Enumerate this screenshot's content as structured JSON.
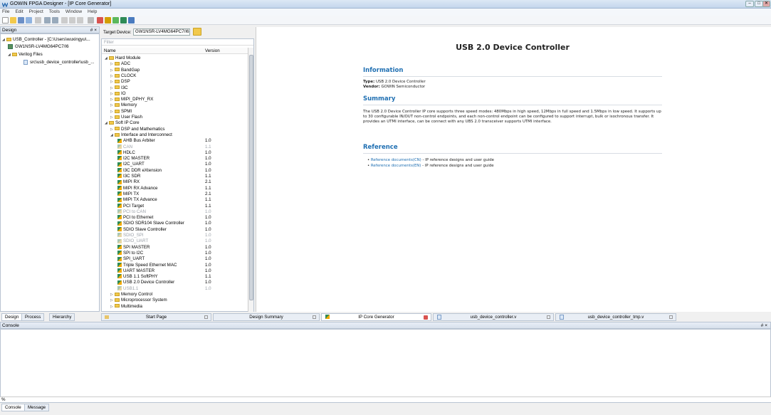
{
  "window": {
    "title": "GOWIN FPGA Designer - [IP Core Generator]",
    "min": "–",
    "max": "□",
    "close": "✕"
  },
  "menu": [
    "File",
    "Edit",
    "Project",
    "Tools",
    "Window",
    "Help"
  ],
  "design": {
    "header": "Design",
    "header_btns": "# ×",
    "project": "USB_Controller - [C:\\Users\\wuxingyu\\...",
    "device": "GW1NSR-LV4MG64PC7/I6",
    "verilog": "Verilog Files",
    "file": "src\\usb_device_controller\\usb_..."
  },
  "target": {
    "label": "Target Device:",
    "value": "GW1NSR-LV4MG64PC7/I6"
  },
  "filter": {
    "label": "Filter"
  },
  "tree": {
    "col_name": "Name",
    "col_version": "Version",
    "rows": [
      {
        "t": "Hard Module",
        "lvl": 0,
        "k": "open"
      },
      {
        "t": "ADC",
        "lvl": 1,
        "k": "closed"
      },
      {
        "t": "BandGap",
        "lvl": 1,
        "k": "closed"
      },
      {
        "t": "CLOCK",
        "lvl": 1,
        "k": "closed"
      },
      {
        "t": "DSP",
        "lvl": 1,
        "k": "closed"
      },
      {
        "t": "I3C",
        "lvl": 1,
        "k": "closed"
      },
      {
        "t": "IO",
        "lvl": 1,
        "k": "closed"
      },
      {
        "t": "MIPI_DPHY_RX",
        "lvl": 1,
        "k": "closed"
      },
      {
        "t": "Memory",
        "lvl": 1,
        "k": "closed"
      },
      {
        "t": "SPMI",
        "lvl": 1,
        "k": "closed"
      },
      {
        "t": "User Flash",
        "lvl": 1,
        "k": "closed"
      },
      {
        "t": "Soft IP Core",
        "lvl": 0,
        "k": "open"
      },
      {
        "t": "DSP and Mathematics",
        "lvl": 1,
        "k": "closed"
      },
      {
        "t": "Interface and Interconnect",
        "lvl": 1,
        "k": "open"
      },
      {
        "t": "AHB Bus Arbiter",
        "v": "1.0",
        "lvl": 2,
        "k": "ip"
      },
      {
        "t": "CAN",
        "v": "1.1",
        "lvl": 2,
        "k": "ipg"
      },
      {
        "t": "HDLC",
        "v": "1.0",
        "lvl": 2,
        "k": "ip"
      },
      {
        "t": "I2C MASTER",
        "v": "1.0",
        "lvl": 2,
        "k": "ip"
      },
      {
        "t": "I2C_UART",
        "v": "1.0",
        "lvl": 2,
        "k": "ip"
      },
      {
        "t": "I3C DDR eXtension",
        "v": "1.0",
        "lvl": 2,
        "k": "ip"
      },
      {
        "t": "I3C SDR",
        "v": "1.1",
        "lvl": 2,
        "k": "ip"
      },
      {
        "t": "MIPI RX",
        "v": "2.1",
        "lvl": 2,
        "k": "ip"
      },
      {
        "t": "MIPI RX Advance",
        "v": "1.1",
        "lvl": 2,
        "k": "ip"
      },
      {
        "t": "MIPI TX",
        "v": "2.1",
        "lvl": 2,
        "k": "ip"
      },
      {
        "t": "MIPI TX Advance",
        "v": "1.1",
        "lvl": 2,
        "k": "ip"
      },
      {
        "t": "PCI Target",
        "v": "1.1",
        "lvl": 2,
        "k": "ip"
      },
      {
        "t": "PCI to CAN",
        "v": "1.0",
        "lvl": 2,
        "k": "ipg"
      },
      {
        "t": "PCI to Ethernet",
        "v": "1.0",
        "lvl": 2,
        "k": "ip"
      },
      {
        "t": "SDIO SDR104 Slave Controller",
        "v": "1.0",
        "lvl": 2,
        "k": "ip"
      },
      {
        "t": "SDIO Slave Controller",
        "v": "1.0",
        "lvl": 2,
        "k": "ip"
      },
      {
        "t": "SDIO_SPI",
        "v": "1.0",
        "lvl": 2,
        "k": "ipg"
      },
      {
        "t": "SDIO_UART",
        "v": "1.0",
        "lvl": 2,
        "k": "ipg"
      },
      {
        "t": "SPI MASTER",
        "v": "1.0",
        "lvl": 2,
        "k": "ip"
      },
      {
        "t": "SPI to I2C",
        "v": "1.0",
        "lvl": 2,
        "k": "ip"
      },
      {
        "t": "SPI_UART",
        "v": "1.0",
        "lvl": 2,
        "k": "ip"
      },
      {
        "t": "Triple Speed Ethernet MAC",
        "v": "1.0",
        "lvl": 2,
        "k": "ip"
      },
      {
        "t": "UART MASTER",
        "v": "1.0",
        "lvl": 2,
        "k": "ip"
      },
      {
        "t": "USB 1.1 SoftPHY",
        "v": "1.1",
        "lvl": 2,
        "k": "ip"
      },
      {
        "t": "USB 2.0 Device Controller",
        "v": "1.0",
        "lvl": 2,
        "k": "ip",
        "sel": true
      },
      {
        "t": "USB1.1",
        "v": "1.0",
        "lvl": 2,
        "k": "ipg"
      },
      {
        "t": "Memory Control",
        "lvl": 1,
        "k": "closed"
      },
      {
        "t": "Microprocessor System",
        "lvl": 1,
        "k": "closed"
      },
      {
        "t": "Multimedia",
        "lvl": 1,
        "k": "closed"
      }
    ]
  },
  "doc": {
    "title": "USB 2.0 Device Controller",
    "info_h": "Information",
    "type_label": "Type:",
    "type_val": " USB 2.0 Device Controller",
    "vendor_label": "Vendor:",
    "vendor_val": " GOWIN Semiconductor",
    "summary_h": "Summary",
    "summary": "The USB 2.0 Device Controller IP core supports three speed modes: 480Mbps in high speed, 12Mbps in full speed and 1.5Mbps in low speed. It supports up to 30 configurable IN/OUT non-control endpoints, and each non-control endpoint can be configured to support interrupt, bulk or isochronous transfer. It provides an UTMI interface, can be connect with any UBS 2.0 transceiver supports UTMI interface.",
    "ref_h": "Reference",
    "ref1_link": "Reference documents(CN)",
    "ref1_text": " - IP reference designs and user guide",
    "ref2_link": "Reference documents(EN)",
    "ref2_text": " - IP reference designs and user guide"
  },
  "left_tabs": [
    "Design",
    "Process",
    "Hierarchy"
  ],
  "doc_tabs": [
    "Start Page",
    "Design Summary",
    "IP Core Generator",
    "usb_device_controller.v",
    "usb_device_controller_tmp.v"
  ],
  "console": {
    "header": "Console",
    "header_btns": "# ×",
    "prompt": "%",
    "tabs": [
      "Console",
      "Message"
    ]
  }
}
